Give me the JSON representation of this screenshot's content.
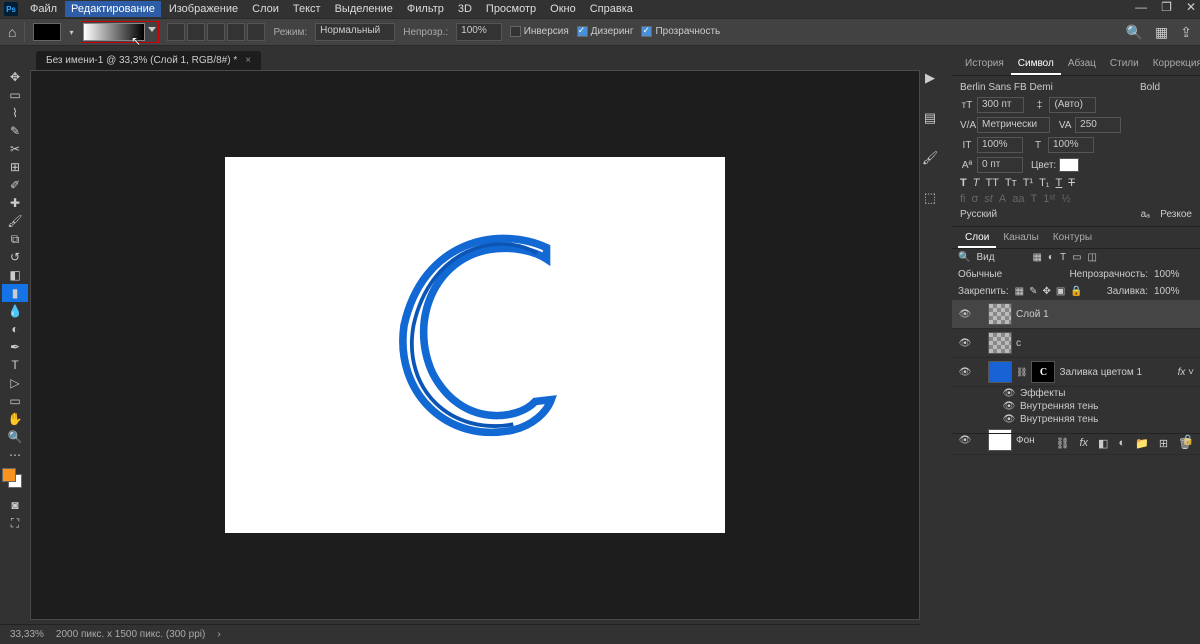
{
  "menu": {
    "items": [
      "Файл",
      "Редактирование",
      "Изображение",
      "Слои",
      "Текст",
      "Выделение",
      "Фильтр",
      "3D",
      "Просмотр",
      "Окно",
      "Справка"
    ],
    "highlighted_index": 1
  },
  "optbar": {
    "mode_label": "Режим:",
    "mode_value": "Нормальный",
    "opacity_label": "Непрозр.:",
    "opacity_value": "100%",
    "cb_inversion": "Инверсия",
    "cb_dither": "Дизеринг",
    "cb_transp": "Прозрачность"
  },
  "doc": {
    "tab_title": "Без имени-1 @ 33,3% (Слой 1, RGB/8#) *"
  },
  "rpanels": {
    "top_tabs": [
      "История",
      "Символ",
      "Абзац",
      "Стили",
      "Коррекция"
    ],
    "top_active": 1
  },
  "char": {
    "font": "Berlin Sans FB Demi",
    "weight": "Bold",
    "size": "300 пт",
    "leading": "(Авто)",
    "kerning": "Метрически",
    "tracking": "250",
    "vscale": "100%",
    "hscale": "100%",
    "baseline": "0 пт",
    "color_label": "Цвет:",
    "lang": "Русский",
    "aa": "Резкое"
  },
  "layers": {
    "tabs": [
      "Слои",
      "Каналы",
      "Контуры"
    ],
    "active": 0,
    "kind_label": "Вид",
    "blend": "Обычные",
    "opacity_label": "Непрозрачность:",
    "opacity": "100%",
    "lock_label": "Закрепить:",
    "fill_label": "Заливка:",
    "fill": "100%",
    "items": [
      {
        "name": "Слой 1",
        "sel": true,
        "thumb": "transp"
      },
      {
        "name": "c",
        "thumb": "transp"
      },
      {
        "name": "Заливка цветом 1",
        "thumb": "blue",
        "mask": "C",
        "fx": true
      },
      {
        "name": "Фон",
        "thumb": "white",
        "lock": true
      }
    ],
    "fx_label": "Эффекты",
    "fx_items": [
      "Внутренняя тень",
      "Внутренняя тень"
    ]
  },
  "status": {
    "zoom": "33,33%",
    "doc": "2000 пикс. x 1500 пикс. (300 ppi)"
  },
  "icons": {
    "home": "⌂",
    "search": "🔍",
    "grid": "▦",
    "share": "⇪",
    "play": "▶",
    "char_T": "T",
    "para": "¶",
    "eye": "👁",
    "link": "⛓",
    "mask": "◧",
    "fx": "fx",
    "trash": "🗑",
    "folder": "📁",
    "new": "⊞"
  }
}
